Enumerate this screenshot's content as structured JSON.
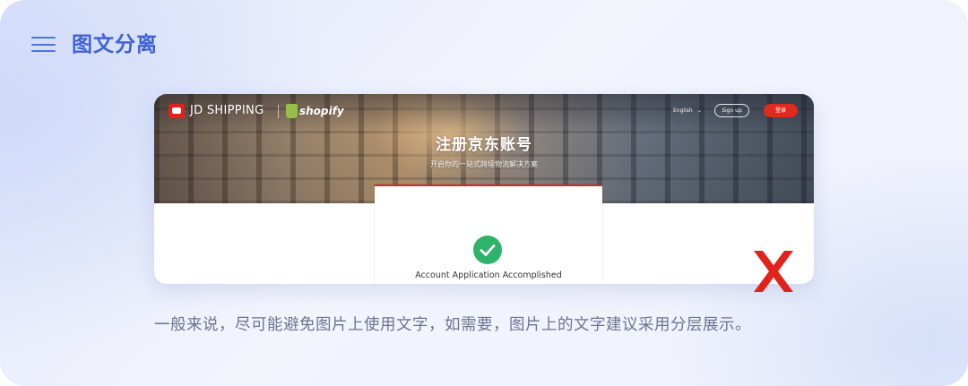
{
  "section": {
    "title": "图文分离",
    "menu_icon": "hamburger-menu-icon"
  },
  "preview": {
    "brand": {
      "jd": "JD SHIPPING",
      "shopify": "shopify"
    },
    "nav": {
      "language": "English",
      "signup": "Sign up",
      "login": "登录"
    },
    "hero": {
      "title": "注册京东账号",
      "subtitle": "开启你的一站式跨境物流解决方案"
    },
    "panel": {
      "success_text": "Account Application Accomplished",
      "icon": "check-circle-icon"
    }
  },
  "verdict_icon": "red-cross-icon",
  "colors": {
    "accent": "#3f63d4",
    "cross": "#e2231a",
    "success": "#2fb36b",
    "login": "#e02a1f"
  },
  "caption": "一般来说，尽可能避免图片上使用文字，如需要，图片上的文字建议采用分层展示。"
}
